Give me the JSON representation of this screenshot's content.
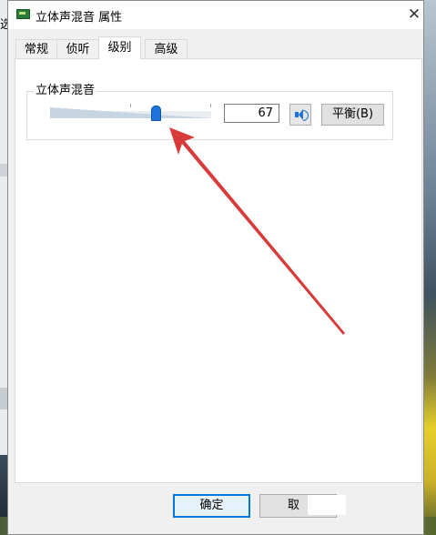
{
  "window": {
    "title": "立体声混音 属性",
    "close_label": "✕"
  },
  "background": {
    "left_text": "选"
  },
  "tabs": [
    {
      "label": "常规"
    },
    {
      "label": "侦听"
    },
    {
      "label": "级别",
      "active": true
    },
    {
      "label": "高级"
    }
  ],
  "levels": {
    "group_label": "立体声混音",
    "slider_value": 67,
    "value_text": "67",
    "balance_label": "平衡(B)",
    "mute_icon": "speaker-icon"
  },
  "annotation": {
    "color": "#d93a3a",
    "icon": "red-arrow"
  },
  "footer": {
    "ok_label": "确定",
    "cancel_label": "取"
  },
  "colors": {
    "accent": "#1e74d8",
    "ok_border": "#0078d7"
  }
}
